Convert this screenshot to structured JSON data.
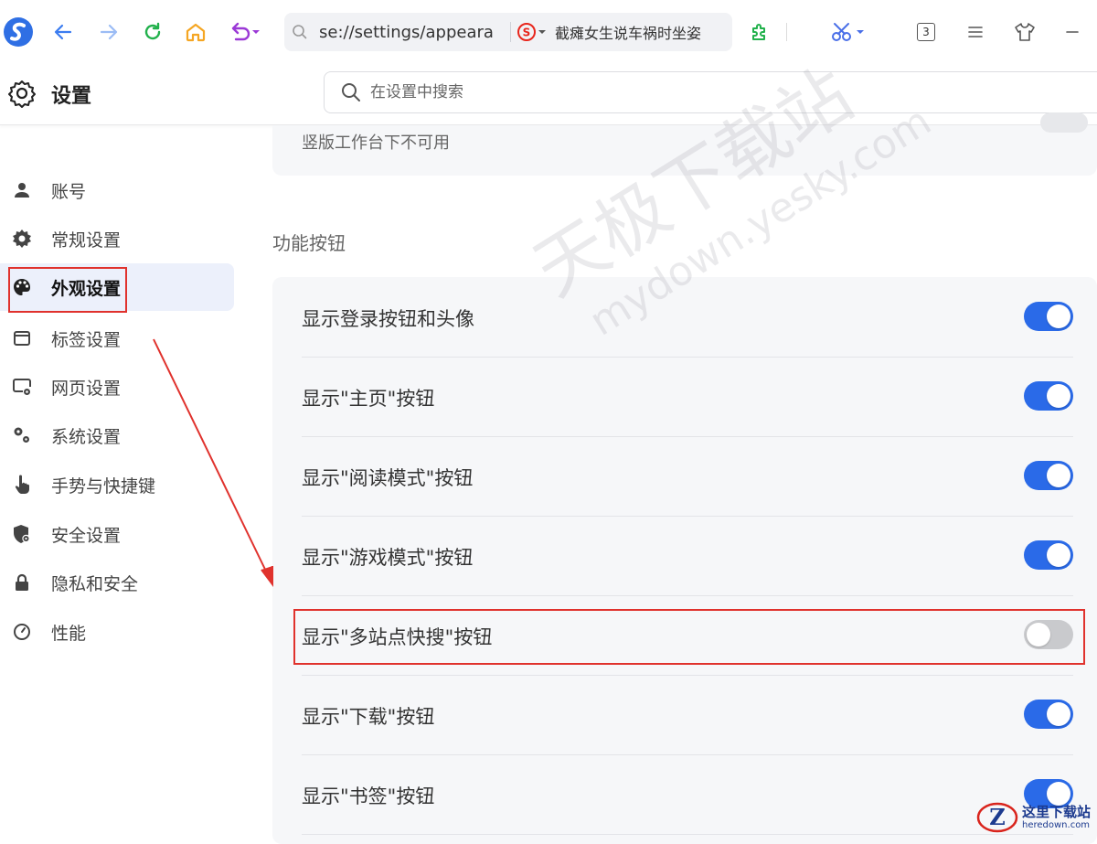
{
  "toolbar": {
    "address_url": "se://settings/appeara",
    "search_text": "截瘫女生说车祸时坐姿",
    "tab_count": "3"
  },
  "header": {
    "title": "设置",
    "search_placeholder": "在设置中搜索"
  },
  "sidebar": {
    "items": [
      {
        "label": "账号",
        "icon": "user-icon"
      },
      {
        "label": "常规设置",
        "icon": "gear-icon"
      },
      {
        "label": "外观设置",
        "icon": "palette-icon",
        "active": true
      },
      {
        "label": "标签设置",
        "icon": "tab-window-icon"
      },
      {
        "label": "网页设置",
        "icon": "webpage-gear-icon"
      },
      {
        "label": "系统设置",
        "icon": "system-gears-icon"
      },
      {
        "label": "手势与快捷键",
        "icon": "hand-pointer-icon"
      },
      {
        "label": "安全设置",
        "icon": "shield-gear-icon"
      },
      {
        "label": "隐私和安全",
        "icon": "lock-icon"
      },
      {
        "label": "性能",
        "icon": "gauge-icon"
      }
    ]
  },
  "main": {
    "top_note": "竖版工作台下不可用",
    "section_title": "功能按钮",
    "rows": [
      {
        "label": "显示登录按钮和头像",
        "enabled": true
      },
      {
        "label": "显示\"主页\"按钮",
        "enabled": true
      },
      {
        "label": "显示\"阅读模式\"按钮",
        "enabled": true
      },
      {
        "label": "显示\"游戏模式\"按钮",
        "enabled": true
      },
      {
        "label": "显示\"多站点快搜\"按钮",
        "enabled": false
      },
      {
        "label": "显示\"下载\"按钮",
        "enabled": true
      },
      {
        "label": "显示\"书签\"按钮",
        "enabled": true
      }
    ]
  },
  "watermark": {
    "line1": "天极下载站",
    "line2": "mydown.yesky.com"
  },
  "brand": {
    "name": "这里下载站",
    "url": "heredown.com"
  },
  "colors": {
    "accent": "#2a6ae8",
    "highlight_red": "#e0322d",
    "toggle_off": "#c9cacd"
  }
}
